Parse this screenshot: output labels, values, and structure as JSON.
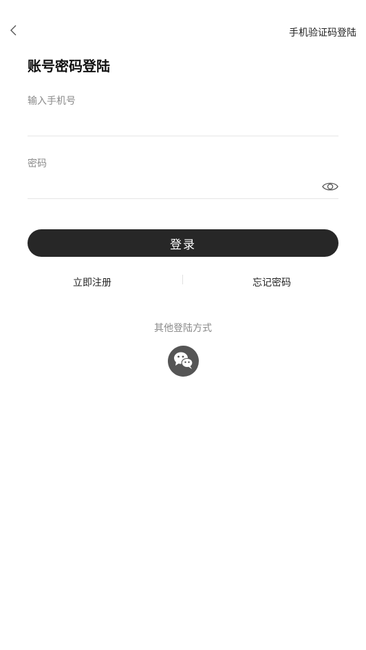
{
  "header": {
    "back_icon": "chevron-left-icon",
    "sms_login_label": "手机验证码登陆"
  },
  "title": "账号密码登陆",
  "phone_field": {
    "label": "输入手机号",
    "value": ""
  },
  "password_field": {
    "label": "密码",
    "value": "",
    "visibility_icon": "eye-icon"
  },
  "login_button_label": "登录",
  "links": {
    "register": "立即注册",
    "forgot_password": "忘记密码"
  },
  "other_login": {
    "label": "其他登陆方式",
    "wechat_icon": "wechat-icon"
  },
  "colors": {
    "button_bg": "#272727",
    "icon_circle": "#555555",
    "muted_text": "#8a8a8a"
  }
}
